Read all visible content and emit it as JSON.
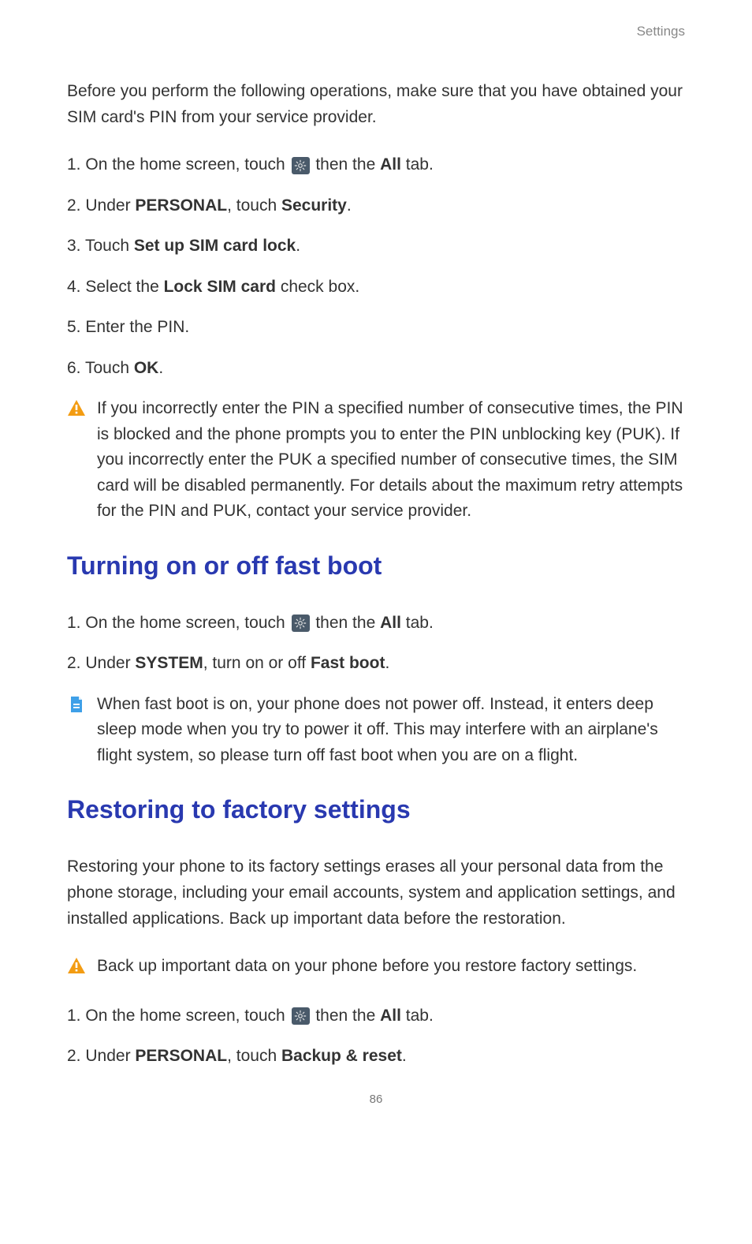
{
  "header": {
    "label": "Settings"
  },
  "intro_sim": "Before you perform the following operations, make sure that you have obtained your SIM card's PIN from your service provider.",
  "sim_steps": {
    "s1_pre": "On the home screen, touch ",
    "s1_post": " then the ",
    "s1_all": "All",
    "s1_tab": " tab.",
    "s2_pre": "Under ",
    "s2_personal": "PERSONAL",
    "s2_mid": ", touch ",
    "s2_security": "Security",
    "s2_end": ".",
    "s3_pre": "Touch ",
    "s3_bold": "Set up SIM card lock",
    "s3_end": ".",
    "s4_pre": "Select the ",
    "s4_bold": "Lock SIM card",
    "s4_end": " check box.",
    "s5": "Enter the PIN.",
    "s6_pre": "Touch ",
    "s6_bold": "OK",
    "s6_end": "."
  },
  "warning_sim": "If you incorrectly enter the PIN a specified number of consecutive times, the PIN is blocked and the phone prompts you to enter the PIN unblocking key (PUK). If you incorrectly enter the PUK a specified number of consecutive times, the SIM card will be disabled permanently. For details about the maximum retry attempts for the PIN and PUK, contact your service provider.",
  "heading_fastboot": "Turning on or off fast boot",
  "fastboot_steps": {
    "s1_pre": "On the home screen, touch ",
    "s1_post": " then the ",
    "s1_all": "All",
    "s1_tab": " tab.",
    "s2_pre": "Under ",
    "s2_system": "SYSTEM",
    "s2_mid": ", turn on or off ",
    "s2_bold": "Fast boot",
    "s2_end": "."
  },
  "note_fastboot": "When fast boot is on, your phone does not power off. Instead, it enters deep sleep mode when you try to power it off. This may interfere with an airplane's flight system, so please turn off fast boot when you are on a flight.",
  "heading_factory": "Restoring to factory settings",
  "intro_factory": "Restoring your phone to its factory settings erases all your personal data from the phone storage, including your email accounts, system and application settings, and installed applications. Back up important data before the restoration.",
  "warning_factory": "Back up important data on your phone before you restore factory settings.",
  "factory_steps": {
    "s1_pre": "On the home screen, touch ",
    "s1_post": " then the ",
    "s1_all": "All",
    "s1_tab": " tab.",
    "s2_pre": "Under ",
    "s2_personal": "PERSONAL",
    "s2_mid": ", touch ",
    "s2_bold": "Backup & reset",
    "s2_end": "."
  },
  "page_number": "86"
}
